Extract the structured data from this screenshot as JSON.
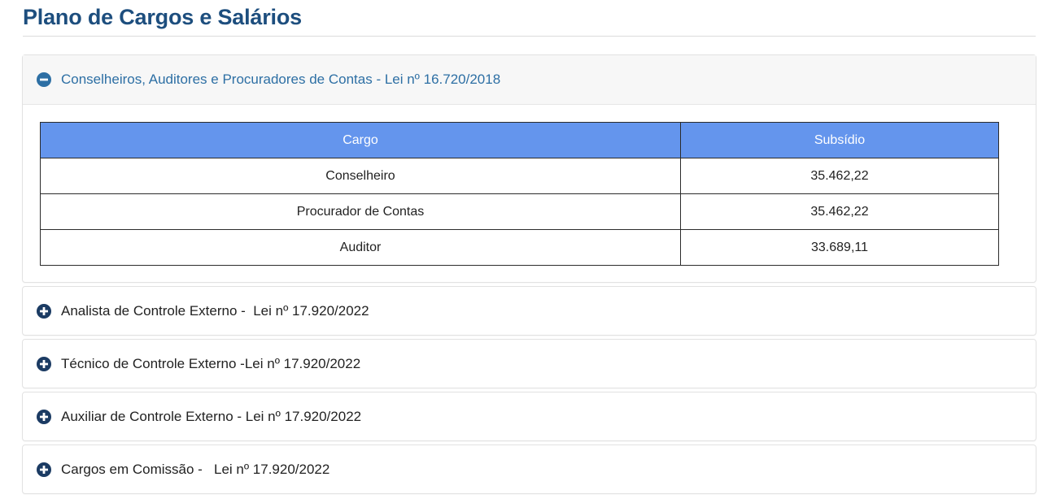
{
  "page": {
    "title": "Plano de Cargos e Salários"
  },
  "colors": {
    "title": "#1d4e7e",
    "open_header_text": "#2d6fa4",
    "table_header_bg": "#6495ed",
    "icon_collapsed": "#1b3b63",
    "icon_expanded": "#2d6fa4"
  },
  "accordion": {
    "panels": [
      {
        "label": "Conselheiros, Auditores e Procuradores de Contas - Lei nº 16.720/2018",
        "expanded": true,
        "icon": "minus-circle-icon",
        "table": {
          "headers": [
            "Cargo",
            "Subsídio"
          ],
          "rows": [
            [
              "Conselheiro",
              "35.462,22"
            ],
            [
              "Procurador de Contas",
              "35.462,22"
            ],
            [
              "Auditor",
              "33.689,11"
            ]
          ]
        }
      },
      {
        "label": "Analista de Controle Externo -  Lei nº 17.920/2022",
        "expanded": false,
        "icon": "plus-circle-icon"
      },
      {
        "label": "Técnico de Controle Externo -Lei nº 17.920/2022",
        "expanded": false,
        "icon": "plus-circle-icon"
      },
      {
        "label": "Auxiliar de Controle Externo - Lei nº 17.920/2022",
        "expanded": false,
        "icon": "plus-circle-icon"
      },
      {
        "label": "Cargos em Comissão -   Lei nº 17.920/2022",
        "expanded": false,
        "icon": "plus-circle-icon"
      }
    ]
  }
}
